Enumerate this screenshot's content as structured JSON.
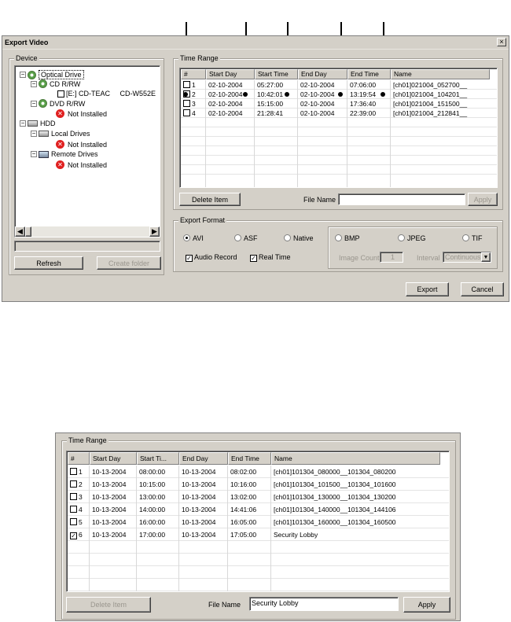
{
  "dialog": {
    "title": "Export Video",
    "close": "×",
    "device": {
      "legend": "Device",
      "tree": {
        "optical_drive": "Optical Drive",
        "cd_rw": "CD R/RW",
        "cd_device": "[E:] CD-TEAC     CD-W552E",
        "dvd_rw": "DVD R/RW",
        "dvd_status": "Not Installed",
        "hdd": "HDD",
        "local_drives": "Local Drives",
        "local_status": "Not Installed",
        "remote_drives": "Remote Drives",
        "remote_status": "Not Installed"
      },
      "refresh_label": "Refresh",
      "create_folder_label": "Create folder"
    },
    "time_range": {
      "legend": "Time Range",
      "columns": [
        "#",
        "Start Day",
        "Start Time",
        "End Day",
        "End Time",
        "Name"
      ],
      "rows": [
        {
          "num": "1",
          "start_day": "02-10-2004",
          "start_time": "05:27:00",
          "end_day": "02-10-2004",
          "end_time": "07:06:00",
          "name": "[ch01]021004_052700__"
        },
        {
          "num": "2",
          "start_day": "02-10-2004",
          "start_time": "10:42:01",
          "end_day": "02-10-2004",
          "end_time": "13:19:54",
          "name": "[ch01]021004_104201__"
        },
        {
          "num": "3",
          "start_day": "02-10-2004",
          "start_time": "15:15:00",
          "end_day": "02-10-2004",
          "end_time": "17:36:40",
          "name": "[ch01]021004_151500__"
        },
        {
          "num": "4",
          "start_day": "02-10-2004",
          "start_time": "21:28:41",
          "end_day": "02-10-2004",
          "end_time": "22:39:00",
          "name": "[ch01]021004_212841__"
        }
      ],
      "delete_label": "Delete Item",
      "file_name_label": "File Name",
      "file_name_value": "",
      "apply_label": "Apply"
    },
    "export_format": {
      "legend": "Export Format",
      "avi": "AVI",
      "asf": "ASF",
      "native": "Native",
      "audio_record": "Audio Record",
      "real_time": "Real Time",
      "bmp": "BMP",
      "jpeg": "JPEG",
      "tif": "TIF",
      "image_count_label": "Image Count",
      "image_count_value": "1",
      "interval_label": "Interval",
      "interval_value": "Continuous"
    },
    "export_label": "Export",
    "cancel_label": "Cancel"
  },
  "panel2": {
    "legend": "Time Range",
    "columns": [
      "#",
      "Start Day",
      "Start Ti...",
      "End Day",
      "End Time",
      "Name"
    ],
    "rows": [
      {
        "num": "1",
        "checked": false,
        "start_day": "10-13-2004",
        "start_time": "08:00:00",
        "end_day": "10-13-2004",
        "end_time": "08:02:00",
        "name": "[ch01]101304_080000__101304_080200"
      },
      {
        "num": "2",
        "checked": false,
        "start_day": "10-13-2004",
        "start_time": "10:15:00",
        "end_day": "10-13-2004",
        "end_time": "10:16:00",
        "name": "[ch01]101304_101500__101304_101600"
      },
      {
        "num": "3",
        "checked": false,
        "start_day": "10-13-2004",
        "start_time": "13:00:00",
        "end_day": "10-13-2004",
        "end_time": "13:02:00",
        "name": "[ch01]101304_130000__101304_130200"
      },
      {
        "num": "4",
        "checked": false,
        "start_day": "10-13-2004",
        "start_time": "14:00:00",
        "end_day": "10-13-2004",
        "end_time": "14:41:06",
        "name": "[ch01]101304_140000__101304_144106"
      },
      {
        "num": "5",
        "checked": false,
        "start_day": "10-13-2004",
        "start_time": "16:00:00",
        "end_day": "10-13-2004",
        "end_time": "16:05:00",
        "name": "[ch01]101304_160000__101304_160500"
      },
      {
        "num": "6",
        "checked": true,
        "start_day": "10-13-2004",
        "start_time": "17:00:00",
        "end_day": "10-13-2004",
        "end_time": "17:05:00",
        "name": "Security Lobby"
      }
    ],
    "delete_label": "Delete Item",
    "file_name_label": "File Name",
    "file_name_value": "Security Lobby",
    "apply_label": "Apply"
  }
}
